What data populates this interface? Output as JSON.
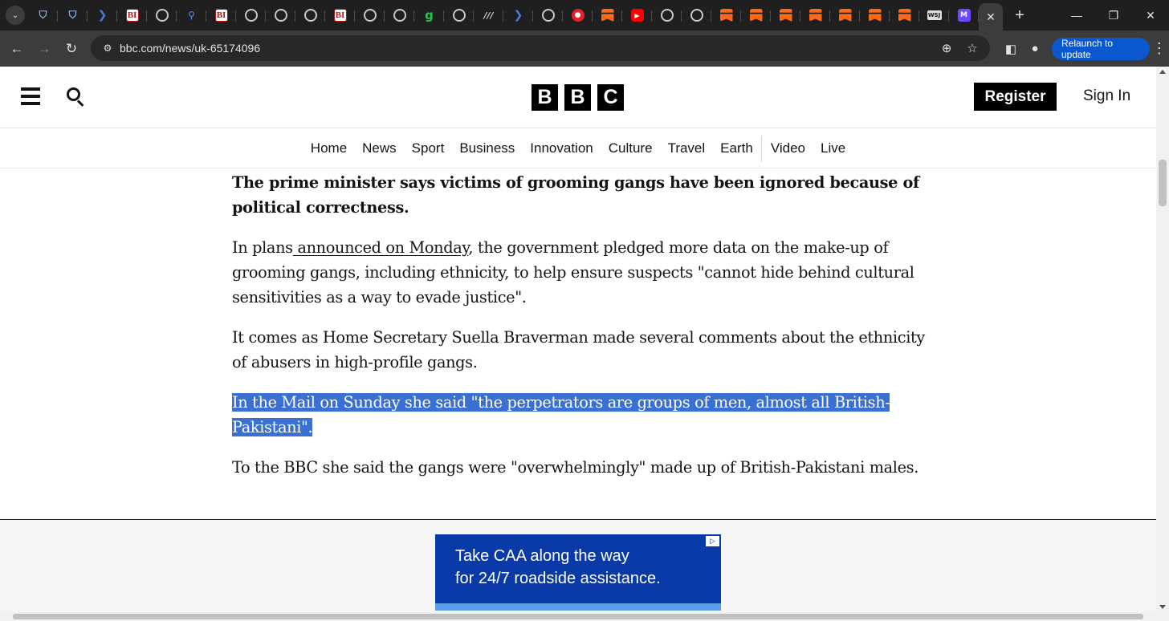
{
  "browser": {
    "url": "bbc.com/news/uk-65174096",
    "relaunch_label": "Relaunch to update",
    "tab_favicons": [
      "shield-icon",
      "shield-icon",
      "arrow-icon",
      "bi-icon",
      "globe-icon",
      "search-icon",
      "bi-icon",
      "globe-icon",
      "globe-icon",
      "globe-icon",
      "bi-icon",
      "globe-icon",
      "globe-icon",
      "g-icon",
      "globe-icon",
      "slash-icon",
      "arrow-icon",
      "globe-icon",
      "mic-icon",
      "substack-icon",
      "youtube-icon",
      "globe-icon",
      "globe-icon",
      "substack-icon",
      "substack-icon",
      "substack-icon",
      "substack-icon",
      "substack-icon",
      "substack-icon",
      "substack-icon",
      "wsj-icon",
      "proton-icon"
    ],
    "tab_glyphs": {
      "bi": "BI",
      "g": "g",
      "slash": "///",
      "youtube": "▶",
      "mic": "●",
      "wsj": "WSJ",
      "proton": "M",
      "shield": "⛉",
      "arrow": "❯",
      "search": "⚲"
    }
  },
  "header": {
    "logo_letters": [
      "B",
      "B",
      "C"
    ],
    "register_label": "Register",
    "signin_label": "Sign In"
  },
  "nav": {
    "items": [
      "Home",
      "News",
      "Sport",
      "Business",
      "Innovation",
      "Culture",
      "Travel",
      "Earth",
      "Video",
      "Live"
    ]
  },
  "article": {
    "lead": "The prime minister says victims of grooming gangs have been ignored because of political correctness.",
    "p1_before": "In plans",
    "p1_link": " announced on Monday",
    "p1_after": ", the government pledged more data on the make-up of grooming gangs, including ethnicity, to help ensure suspects \"cannot hide behind cultural sensitivities as a way to evade justice\".",
    "p2": "It comes as Home Secretary Suella Braverman made several comments about the ethnicity of abusers in high-profile gangs.",
    "p3_line1": "In the Mail on Sunday she said \"the perpetrators are groups of men, almost all British-",
    "p3_line2": "Pakistani\".",
    "p4": "To the BBC she said the gangs were \"overwhelmingly\" made up of British-Pakistani males."
  },
  "ad": {
    "line1": "Take CAA along the way",
    "line2": "for 24/7 roadside assistance."
  },
  "colors": {
    "highlight": "#3a6fd3",
    "relaunch": "#0b57d0",
    "ad_bg": "#0a39a8"
  }
}
